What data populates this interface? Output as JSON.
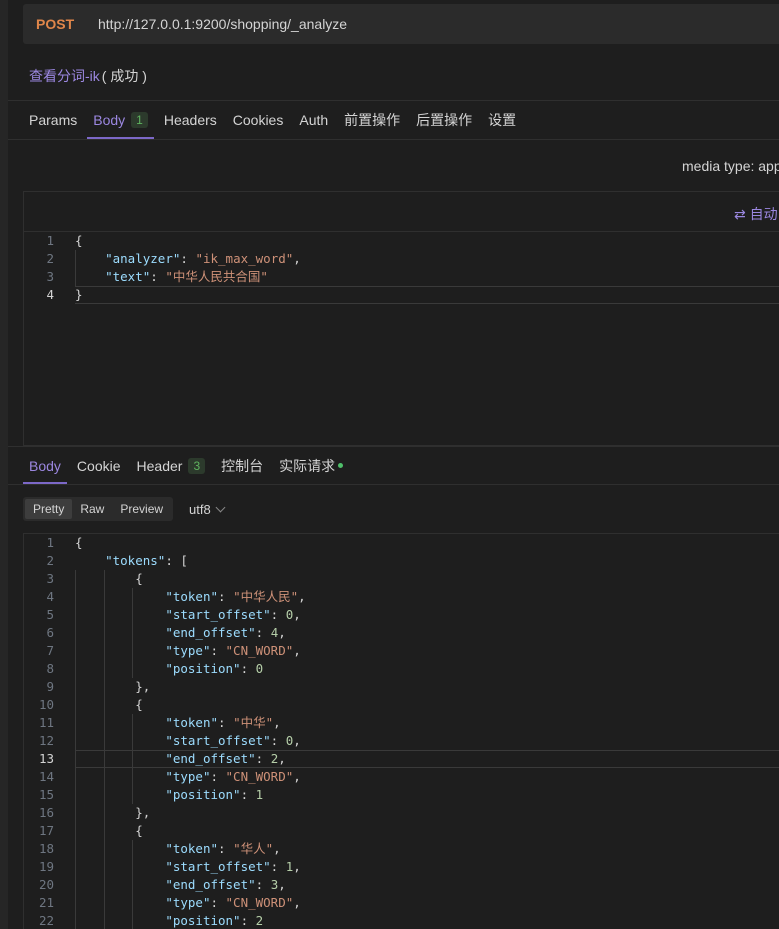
{
  "request": {
    "method": "POST",
    "url": "http://127.0.0.1:9200/shopping/_analyze",
    "name": "查看分词-ik",
    "status": "( 成功 )"
  },
  "request_tabs": [
    {
      "label": "Params"
    },
    {
      "label": "Body",
      "badge": "1",
      "active": true
    },
    {
      "label": "Headers"
    },
    {
      "label": "Cookies"
    },
    {
      "label": "Auth"
    },
    {
      "label": "前置操作"
    },
    {
      "label": "后置操作"
    },
    {
      "label": "设置"
    }
  ],
  "media_type": "media type: app",
  "auto_format": "自动",
  "request_body_lines": [
    {
      "n": "1",
      "html": "<span class='p'>{</span>"
    },
    {
      "n": "2",
      "html": "    <span class='k'>\"analyzer\"</span><span class='p'>: </span><span class='s'>\"ik_max_word\"</span><span class='p'>,</span>"
    },
    {
      "n": "3",
      "html": "    <span class='k'>\"text\"</span><span class='p'>: </span><span class='s'>\"中华人民共合国\"</span>"
    },
    {
      "n": "4",
      "html": "<span class='p'>}</span>",
      "current": true
    }
  ],
  "response_tabs": [
    {
      "label": "Body",
      "active": true
    },
    {
      "label": "Cookie"
    },
    {
      "label": "Header",
      "badge": "3"
    },
    {
      "label": "控制台"
    },
    {
      "label": "实际请求",
      "dot": true
    }
  ],
  "view_modes": [
    "Pretty",
    "Raw",
    "Preview"
  ],
  "active_view": "Pretty",
  "encoding": "utf8",
  "response_lines": [
    {
      "n": "1",
      "html": "<span class='p'>{</span>"
    },
    {
      "n": "2",
      "html": "    <span class='k'>\"tokens\"</span><span class='p'>: [</span>"
    },
    {
      "n": "3",
      "html": "        <span class='p'>{</span>"
    },
    {
      "n": "4",
      "html": "            <span class='k'>\"token\"</span><span class='p'>: </span><span class='s'>\"中华人民\"</span><span class='p'>,</span>"
    },
    {
      "n": "5",
      "html": "            <span class='k'>\"start_offset\"</span><span class='p'>: </span><span class='n'>0</span><span class='p'>,</span>"
    },
    {
      "n": "6",
      "html": "            <span class='k'>\"end_offset\"</span><span class='p'>: </span><span class='n'>4</span><span class='p'>,</span>"
    },
    {
      "n": "7",
      "html": "            <span class='k'>\"type\"</span><span class='p'>: </span><span class='s'>\"CN_WORD\"</span><span class='p'>,</span>"
    },
    {
      "n": "8",
      "html": "            <span class='k'>\"position\"</span><span class='p'>: </span><span class='n'>0</span>"
    },
    {
      "n": "9",
      "html": "        <span class='p'>},</span>"
    },
    {
      "n": "10",
      "html": "        <span class='p'>{</span>"
    },
    {
      "n": "11",
      "html": "            <span class='k'>\"token\"</span><span class='p'>: </span><span class='s'>\"中华\"</span><span class='p'>,</span>"
    },
    {
      "n": "12",
      "html": "            <span class='k'>\"start_offset\"</span><span class='p'>: </span><span class='n'>0</span><span class='p'>,</span>"
    },
    {
      "n": "13",
      "html": "            <span class='k'>\"end_offset\"</span><span class='p'>: </span><span class='n'>2</span><span class='p'>,</span>",
      "current": true
    },
    {
      "n": "14",
      "html": "            <span class='k'>\"type\"</span><span class='p'>: </span><span class='s'>\"CN_WORD\"</span><span class='p'>,</span>"
    },
    {
      "n": "15",
      "html": "            <span class='k'>\"position\"</span><span class='p'>: </span><span class='n'>1</span>"
    },
    {
      "n": "16",
      "html": "        <span class='p'>},</span>"
    },
    {
      "n": "17",
      "html": "        <span class='p'>{</span>"
    },
    {
      "n": "18",
      "html": "            <span class='k'>\"token\"</span><span class='p'>: </span><span class='s'>\"华人\"</span><span class='p'>,</span>"
    },
    {
      "n": "19",
      "html": "            <span class='k'>\"start_offset\"</span><span class='p'>: </span><span class='n'>1</span><span class='p'>,</span>"
    },
    {
      "n": "20",
      "html": "            <span class='k'>\"end_offset\"</span><span class='p'>: </span><span class='n'>3</span><span class='p'>,</span>"
    },
    {
      "n": "21",
      "html": "            <span class='k'>\"type\"</span><span class='p'>: </span><span class='s'>\"CN_WORD\"</span><span class='p'>,</span>"
    },
    {
      "n": "22",
      "html": "            <span class='k'>\"position\"</span><span class='p'>: </span><span class='n'>2</span>"
    }
  ]
}
